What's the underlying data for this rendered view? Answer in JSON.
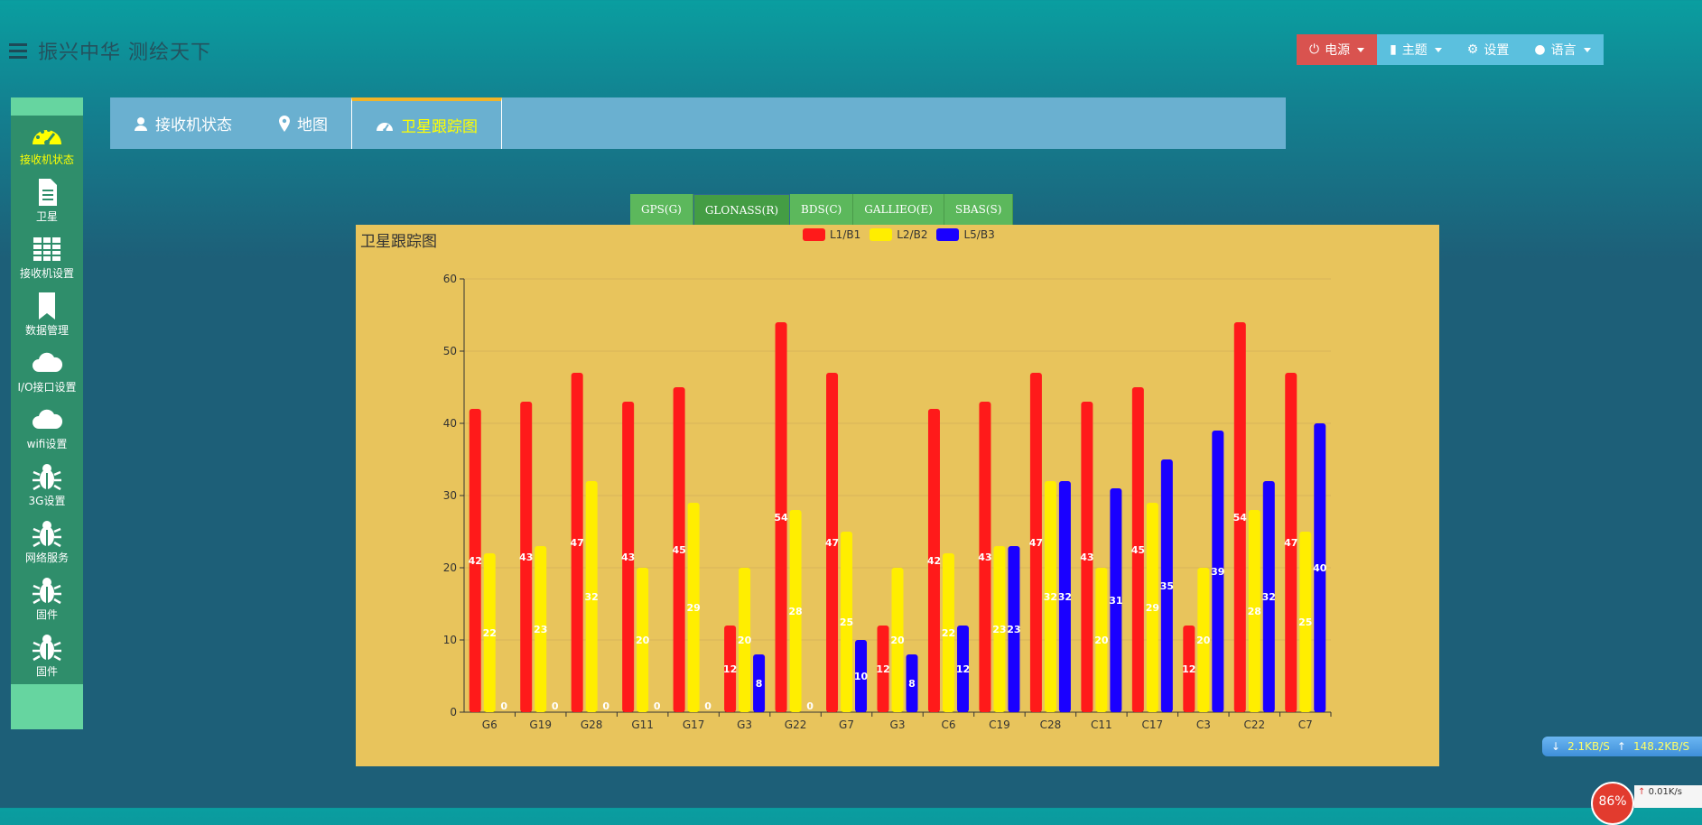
{
  "header": {
    "title": "振兴中华 测绘天下",
    "menu_icon": "hamburger-menu-icon"
  },
  "topbar": {
    "power_label": "电源",
    "theme_label": "主题",
    "settings_label": "设置",
    "language_label": "语言",
    "power_color": "#d9534f",
    "button_color": "#5bc0de"
  },
  "sidebar": {
    "items": [
      {
        "label": "接收机状态",
        "icon": "dashboard-icon",
        "active": true
      },
      {
        "label": "卫星",
        "icon": "document-icon"
      },
      {
        "label": "接收机设置",
        "icon": "table-icon"
      },
      {
        "label": "数据管理",
        "icon": "bookmark-icon"
      },
      {
        "label": "I/O接口设置",
        "icon": "cloud-icon"
      },
      {
        "label": "wifi设置",
        "icon": "cloud-icon"
      },
      {
        "label": "3G设置",
        "icon": "bug-icon"
      },
      {
        "label": "网络服务",
        "icon": "bug-icon"
      },
      {
        "label": "固件",
        "icon": "bug-icon"
      },
      {
        "label": "固件",
        "icon": "bug-icon"
      }
    ]
  },
  "tabs": [
    {
      "label": "接收机状态",
      "icon": "user-icon"
    },
    {
      "label": "地图",
      "icon": "map-marker-icon"
    },
    {
      "label": "卫星跟踪图",
      "icon": "dashboard-icon",
      "active": true
    }
  ],
  "gnss_tabs": [
    {
      "label": "GPS(G)"
    },
    {
      "label": "GLONASS(R)",
      "active": true
    },
    {
      "label": "BDS(C)"
    },
    {
      "label": "GALLIEO(E)"
    },
    {
      "label": "SBAS(S)"
    }
  ],
  "chart_data": {
    "type": "bar",
    "title": "卫星跟踪图",
    "categories": [
      "G6",
      "G19",
      "G28",
      "G11",
      "G17",
      "G3",
      "G22",
      "G7",
      "G3",
      "C6",
      "C19",
      "C28",
      "C11",
      "C17",
      "C3",
      "C22",
      "C7"
    ],
    "series": [
      {
        "name": "L1/B1",
        "color": "#ff1a1a",
        "values": [
          42,
          43,
          47,
          43,
          45,
          12,
          54,
          47,
          12,
          42,
          43,
          47,
          43,
          45,
          12,
          54,
          47
        ]
      },
      {
        "name": "L2/B2",
        "color": "#ffee00",
        "values": [
          22,
          23,
          32,
          20,
          29,
          20,
          28,
          25,
          20,
          22,
          23,
          32,
          20,
          29,
          20,
          28,
          25
        ]
      },
      {
        "name": "L5/B3",
        "color": "#1a00ff",
        "values": [
          0,
          0,
          0,
          0,
          0,
          8,
          0,
          10,
          8,
          12,
          23,
          32,
          31,
          35,
          39,
          32,
          40
        ]
      }
    ],
    "ylim": [
      0,
      60
    ],
    "yticks": [
      0,
      10,
      20,
      30,
      40,
      50,
      60
    ],
    "grid": true,
    "legend_position": "top-center",
    "data_labels": true
  },
  "status": {
    "download_speed": "2.1KB/S",
    "upload_speed": "148.2KB/S",
    "cpu_percent": "86%",
    "net_up": "0.01K/s"
  }
}
